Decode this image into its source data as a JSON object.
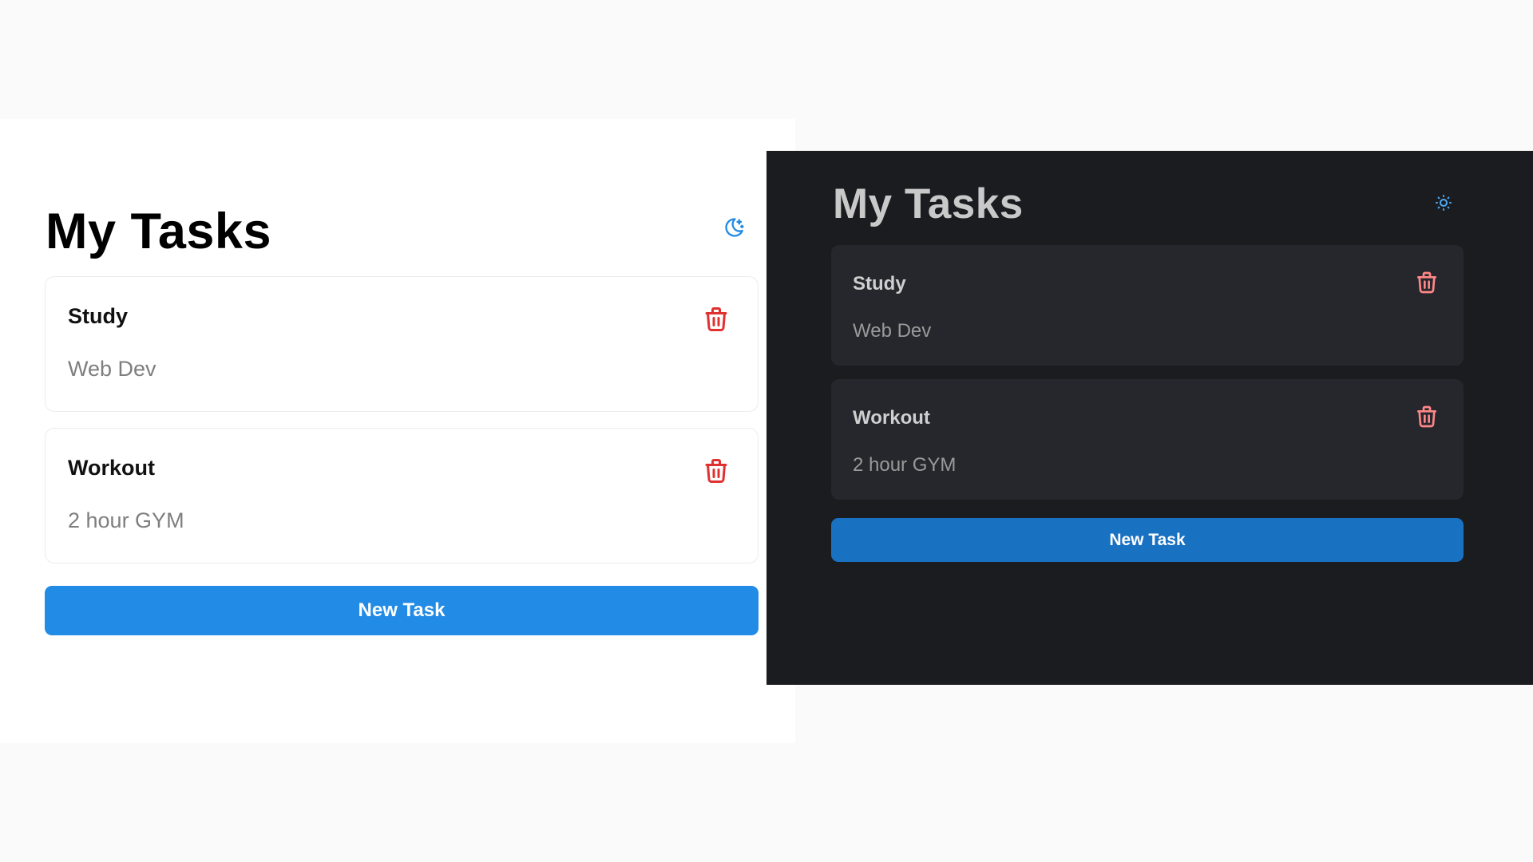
{
  "light": {
    "title": "My Tasks",
    "theme_toggle_icon": "moon-icon",
    "tasks": [
      {
        "title": "Study",
        "description": "Web Dev",
        "delete_icon": "trash-icon"
      },
      {
        "title": "Workout",
        "description": "2 hour GYM",
        "delete_icon": "trash-icon"
      }
    ],
    "new_task_label": "New Task",
    "colors": {
      "background": "#ffffff",
      "accent": "#228be6",
      "delete": "#e03131"
    }
  },
  "dark": {
    "title": "My Tasks",
    "theme_toggle_icon": "sun-icon",
    "tasks": [
      {
        "title": "Study",
        "description": "Web Dev",
        "delete_icon": "trash-icon"
      },
      {
        "title": "Workout",
        "description": "2 hour GYM",
        "delete_icon": "trash-icon"
      }
    ],
    "new_task_label": "New Task",
    "colors": {
      "background": "#1b1c20",
      "card": "#26272c",
      "accent": "#1971c2",
      "delete": "#ff8787"
    }
  }
}
